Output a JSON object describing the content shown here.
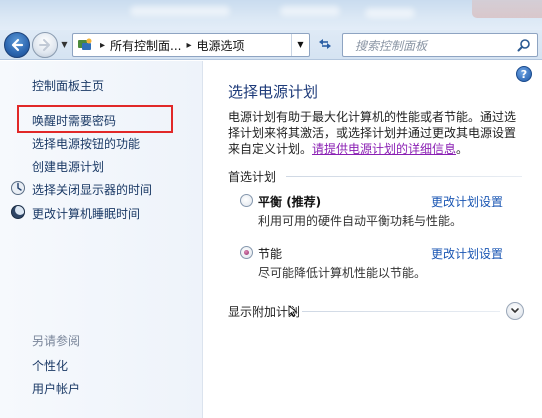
{
  "address": {
    "crumbs": [
      "所有控制面...",
      "电源选项"
    ],
    "separator": "▸"
  },
  "search": {
    "placeholder": "搜索控制面板"
  },
  "sidebar": {
    "home": "控制面板主页",
    "items": [
      {
        "label": "唤醒时需要密码",
        "icon": ""
      },
      {
        "label": "选择电源按钮的功能",
        "icon": ""
      },
      {
        "label": "创建电源计划",
        "icon": ""
      },
      {
        "label": "选择关闭显示器的时间",
        "icon": "monitor-icon"
      },
      {
        "label": "更改计算机睡眠时间",
        "icon": "moon-icon"
      }
    ],
    "see_also_title": "另请参阅",
    "see_also": [
      "个性化",
      "用户帐户"
    ]
  },
  "main": {
    "help": "?",
    "title": "选择电源计划",
    "description": "电源计划有助于最大化计算机的性能或者节能。通过选择计划来将其激活，或选择计划并通过更改其电源设置来自定义计划。",
    "description_link": "请提供电源计划的详细信息",
    "description_end": "。",
    "section_title": "首选计划",
    "plans": [
      {
        "name": "平衡",
        "tag": " (推荐)",
        "desc": "利用可用的硬件自动平衡功耗与性能。",
        "change": "更改计划设置",
        "selected": false
      },
      {
        "name": "节能",
        "tag": "",
        "desc": "尽可能降低计算机性能以节能。",
        "change": "更改计划设置",
        "selected": true
      }
    ],
    "extra_plans": "显示附加计划"
  },
  "colors": {
    "link": "#1a56b3",
    "title": "#1e3b7a",
    "highlight": "#e12828",
    "visited": "#8a1fb3"
  }
}
